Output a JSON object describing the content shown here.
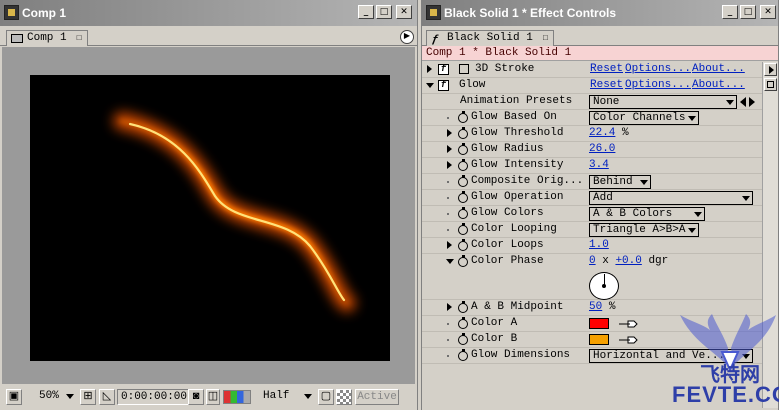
{
  "comp_window": {
    "title": "Comp 1",
    "tab_label": "Comp 1",
    "zoom": "50%",
    "timecode": "0:00:00:00",
    "resolution": "Half",
    "active_label": "Active"
  },
  "effects_window": {
    "title": "Black Solid 1 * Effect Controls",
    "tab_label": "Black Solid 1",
    "path": "Comp 1 * Black Solid 1",
    "reset_label": "Reset",
    "options_label": "Options...",
    "about_label": "About...",
    "effects": [
      {
        "name": "3D Stroke"
      },
      {
        "name": "Glow"
      }
    ],
    "animation_presets": {
      "label": "Animation Presets",
      "value": "None"
    },
    "params": {
      "glow_based_on": {
        "label": "Glow Based On",
        "value": "Color Channels"
      },
      "glow_threshold": {
        "label": "Glow Threshold",
        "value": "22.4",
        "unit": "%"
      },
      "glow_radius": {
        "label": "Glow Radius",
        "value": "26.0"
      },
      "glow_intensity": {
        "label": "Glow Intensity",
        "value": "3.4"
      },
      "composite_original": {
        "label": "Composite Orig...",
        "value": "Behind"
      },
      "glow_operation": {
        "label": "Glow Operation",
        "value": "Add"
      },
      "glow_colors": {
        "label": "Glow Colors",
        "value": "A & B Colors"
      },
      "color_looping": {
        "label": "Color Looping",
        "value": "Triangle A>B>A"
      },
      "color_loops": {
        "label": "Color Loops",
        "value": "1.0"
      },
      "color_phase": {
        "label": "Color Phase",
        "revolutions": "0",
        "x_sep": "x",
        "degrees": "+0.0",
        "unit": "dgr"
      },
      "ab_midpoint": {
        "label": "A & B Midpoint",
        "value": "50",
        "unit": "%"
      },
      "color_a": {
        "label": "Color A",
        "color": "#ff0000"
      },
      "color_b": {
        "label": "Color B",
        "color": "#f5a000"
      },
      "glow_dimensions": {
        "label": "Glow Dimensions",
        "value": "Horizontal and Ve..."
      }
    }
  },
  "watermark": {
    "cn": "飞特网",
    "en": "FEVTE.COM"
  },
  "colors": {
    "link": "#0020c0",
    "path_bg": "#f7d3d3",
    "glow_core": "#ffe27a",
    "glow_mid": "#ff7a00"
  }
}
